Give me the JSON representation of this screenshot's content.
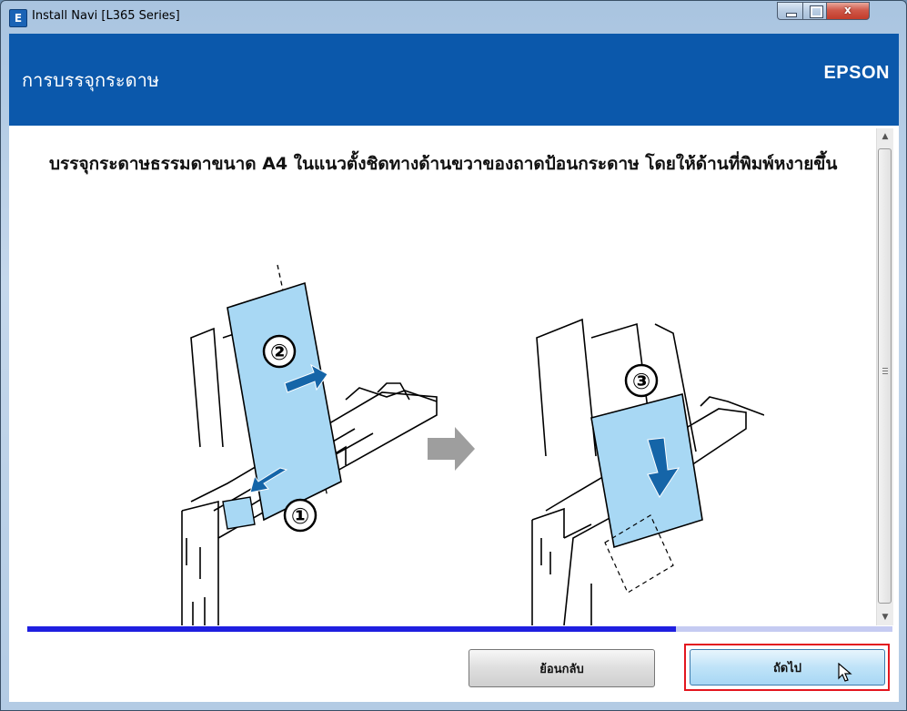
{
  "window": {
    "title": "Install Navi [L365 Series]",
    "icon_letter": "E",
    "controls": [
      "minimize-icon",
      "maximize-icon",
      "close-icon"
    ],
    "close_glyph": "x"
  },
  "header": {
    "title": "การบรรจุกระดาษ",
    "brand": "EPSON",
    "background_color": "#0b58ab"
  },
  "content": {
    "instruction": "บรรจุกระดาษธรรมดาขนาด A4 ในแนวตั้งชิดทางด้านขวาของถาดป้อนกระดาษ โดยให้ด้านที่พิมพ์หงายขึ้น",
    "illustration": {
      "step_labels": [
        "②",
        "①",
        "③"
      ],
      "paper_color": "#a8d8f4",
      "arrow_color": "#1565a8"
    }
  },
  "progress": {
    "fraction": 0.75,
    "fill_color": "#1f1fe0"
  },
  "buttons": {
    "back_label": "ย้อนกลับ",
    "next_label": "ถัดไป"
  },
  "highlight_color": "#e3161f"
}
